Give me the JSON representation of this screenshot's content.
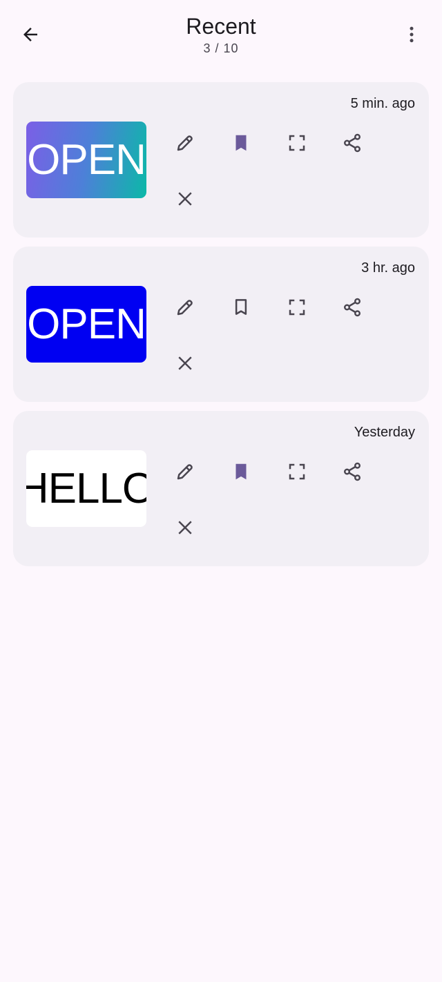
{
  "header": {
    "title": "Recent",
    "subtitle": "3 / 10",
    "back_icon": "arrow-back-icon",
    "menu_icon": "more-vert-icon"
  },
  "colors": {
    "background": "#fdf7fd",
    "card": "#f2eff5",
    "icon": "#49454f",
    "bookmark_filled": "#6b5a9a"
  },
  "items": [
    {
      "time": "5 min. ago",
      "thumb_text": "OPEN",
      "thumb_style": "gradient",
      "bookmarked": true
    },
    {
      "time": "3 hr. ago",
      "thumb_text": "OPEN",
      "thumb_style": "blue",
      "bookmarked": false
    },
    {
      "time": "Yesterday",
      "thumb_text": "HELLO",
      "thumb_style": "white",
      "bookmarked": true
    }
  ],
  "actions": {
    "edit_icon": "pencil-icon",
    "bookmark_icon": "bookmark-icon",
    "fullscreen_icon": "fullscreen-icon",
    "share_icon": "share-icon",
    "delete_icon": "close-icon"
  }
}
